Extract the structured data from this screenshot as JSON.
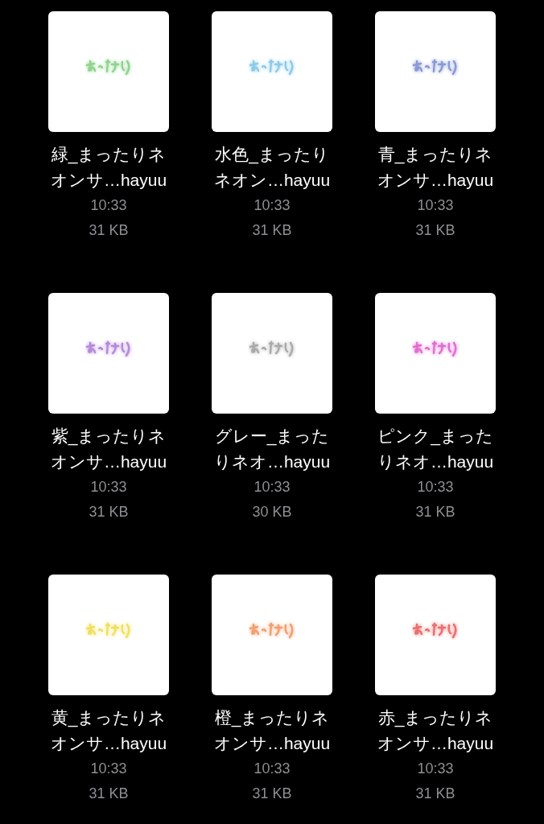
{
  "files": [
    {
      "name": "緑_まったりネオンサ…hayuu",
      "time": "10:33",
      "size": "31 KB",
      "color": "#8fd48f"
    },
    {
      "name": "水色_まったりネオン…hayuu",
      "time": "10:33",
      "size": "31 KB",
      "color": "#8ecbe8"
    },
    {
      "name": "青_まったりネオンサ…hayuu",
      "time": "10:33",
      "size": "31 KB",
      "color": "#8a9ad6"
    },
    {
      "name": "紫_まったりネオンサ…hayuu",
      "time": "10:33",
      "size": "31 KB",
      "color": "#b58ad8"
    },
    {
      "name": "グレー_まったりネオ…hayuu",
      "time": "10:33",
      "size": "30 KB",
      "color": "#aaaaaa"
    },
    {
      "name": "ピンク_まったりネオ…hayuu",
      "time": "10:33",
      "size": "31 KB",
      "color": "#e070d0"
    },
    {
      "name": "黄_まったりネオンサ…hayuu",
      "time": "10:33",
      "size": "31 KB",
      "color": "#f0e060"
    },
    {
      "name": "橙_まったりネオンサ…hayuu",
      "time": "10:33",
      "size": "31 KB",
      "color": "#f0a070"
    },
    {
      "name": "赤_まったりネオンサ…hayuu",
      "time": "10:33",
      "size": "31 KB",
      "color": "#e87070"
    }
  ]
}
